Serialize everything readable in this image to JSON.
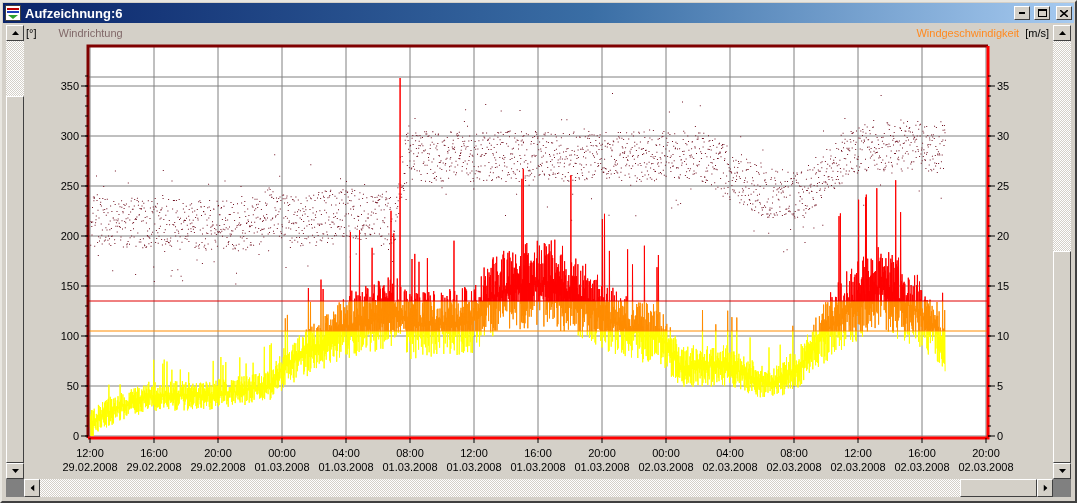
{
  "window": {
    "title": "Aufzeichnung:6"
  },
  "left_axis": {
    "unit": "[°]",
    "label": "Windrichtung",
    "ticks": [
      "350",
      "300",
      "250",
      "200",
      "150",
      "100",
      "50",
      "0"
    ]
  },
  "right_axis": {
    "label": "Windgeschwindigkeit",
    "unit": "[m/s]",
    "ticks": [
      "35",
      "30",
      "25",
      "20",
      "15",
      "10",
      "5",
      "0"
    ]
  },
  "x_axis": {
    "ticks": [
      {
        "time": "12:00",
        "date": "29.02.2008"
      },
      {
        "time": "16:00",
        "date": "29.02.2008"
      },
      {
        "time": "20:00",
        "date": "29.02.2008"
      },
      {
        "time": "00:00",
        "date": "01.03.2008"
      },
      {
        "time": "04:00",
        "date": "01.03.2008"
      },
      {
        "time": "08:00",
        "date": "01.03.2008"
      },
      {
        "time": "12:00",
        "date": "01.03.2008"
      },
      {
        "time": "16:00",
        "date": "01.03.2008"
      },
      {
        "time": "20:00",
        "date": "01.03.2008"
      },
      {
        "time": "00:00",
        "date": "02.03.2008"
      },
      {
        "time": "04:00",
        "date": "02.03.2008"
      },
      {
        "time": "08:00",
        "date": "02.03.2008"
      },
      {
        "time": "12:00",
        "date": "02.03.2008"
      },
      {
        "time": "16:00",
        "date": "02.03.2008"
      },
      {
        "time": "20:00",
        "date": "02.03.2008"
      }
    ]
  }
}
